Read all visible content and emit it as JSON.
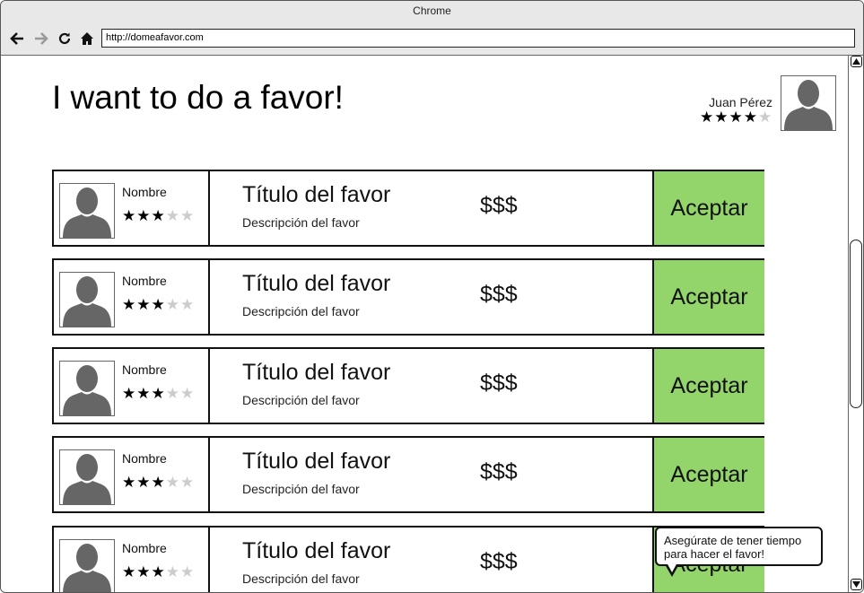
{
  "window": {
    "title": "Chrome"
  },
  "browser": {
    "url": "http://domeafavor.com",
    "icons": [
      "back-arrow-icon",
      "forward-arrow-icon",
      "refresh-icon",
      "home-icon"
    ]
  },
  "header": {
    "title": "I want to do a favor!",
    "user": {
      "name": "Juan Pérez",
      "rating": 4,
      "max_rating": 5
    }
  },
  "favors": [
    {
      "name": "Nombre",
      "rating": 3,
      "max_rating": 5,
      "title": "Título del favor",
      "description": "Descripción del favor",
      "price": "$$$",
      "button": "Aceptar"
    },
    {
      "name": "Nombre",
      "rating": 3,
      "max_rating": 5,
      "title": "Título del favor",
      "description": "Descripción del favor",
      "price": "$$$",
      "button": "Aceptar"
    },
    {
      "name": "Nombre",
      "rating": 3,
      "max_rating": 5,
      "title": "Título del favor",
      "description": "Descripción del favor",
      "price": "$$$",
      "button": "Aceptar"
    },
    {
      "name": "Nombre",
      "rating": 3,
      "max_rating": 5,
      "title": "Título del favor",
      "description": "Descripción del favor",
      "price": "$$$",
      "button": "Aceptar"
    },
    {
      "name": "Nombre",
      "rating": 3,
      "max_rating": 5,
      "title": "Título del favor",
      "description": "Descripción del favor",
      "price": "$$$",
      "button": "Aceptar"
    }
  ],
  "tooltip": {
    "text": "Asegúrate de tener tiempo para hacer el favor!"
  },
  "colors": {
    "accept": "#93d46b",
    "avatar": "#666666",
    "star_on": "#000000",
    "star_off": "#cccccc"
  }
}
